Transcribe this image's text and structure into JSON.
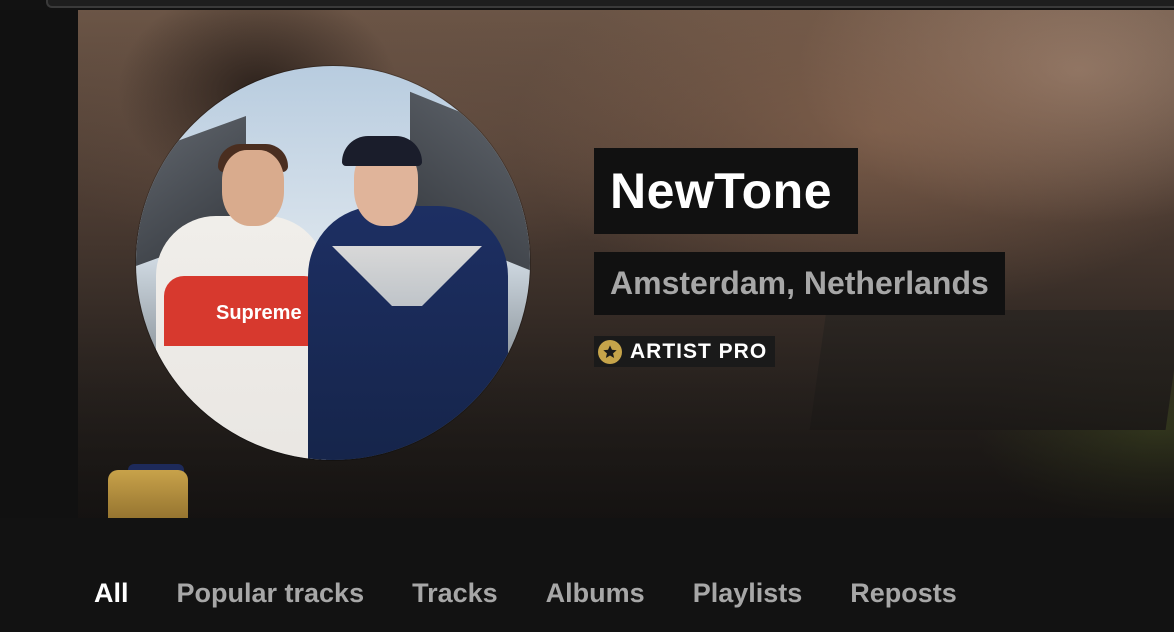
{
  "profile": {
    "name": "NewTone",
    "location": "Amsterdam, Netherlands",
    "badge_label": "ARTIST PRO",
    "badge_icon": "star-icon",
    "avatar_text": "Supreme"
  },
  "tabs": [
    {
      "label": "All",
      "active": true
    },
    {
      "label": "Popular tracks",
      "active": false
    },
    {
      "label": "Tracks",
      "active": false
    },
    {
      "label": "Albums",
      "active": false
    },
    {
      "label": "Playlists",
      "active": false
    },
    {
      "label": "Reposts",
      "active": false
    }
  ],
  "colors": {
    "background": "#121212",
    "tab_active": "#ffffff",
    "tab_inactive": "#a7a7a7",
    "badge_gold": "#c6a44a"
  }
}
